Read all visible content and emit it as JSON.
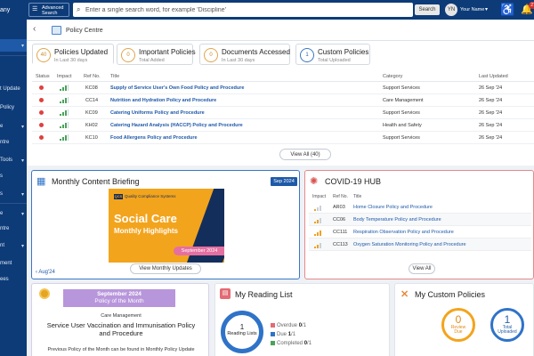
{
  "sidebar": {
    "brand_fragment": "any",
    "items": [
      {
        "label": ""
      },
      {
        "label": ""
      },
      {
        "label": "t Update"
      },
      {
        "label": "Policy"
      },
      {
        "label": "e"
      },
      {
        "label": "ntre"
      },
      {
        "label": "Tools"
      },
      {
        "label": "s"
      },
      {
        "label": "s"
      },
      {
        "label": "e"
      },
      {
        "label": "ntre"
      },
      {
        "label": "nt"
      },
      {
        "label": "ment"
      },
      {
        "label": "ees"
      }
    ]
  },
  "topbar": {
    "advanced_search_line1": "Advanced",
    "advanced_search_line2": "Search",
    "search_placeholder": "Enter a single search word, for example 'Discipline'",
    "search_button": "Search",
    "avatar_initials": "YN",
    "user_name": "Your Name",
    "notification_count": "27"
  },
  "breadcrumb": {
    "title": "Policy Centre"
  },
  "tabs": [
    {
      "count": "40",
      "title": "Policies Updated",
      "subtitle": "In Last 30 days"
    },
    {
      "count": "0",
      "title": "Important Policies",
      "subtitle": "Total Added"
    },
    {
      "count": "0",
      "title": "Documents Accessed",
      "subtitle": "In Last 30 days"
    },
    {
      "count": "1",
      "title": "Custom Policies",
      "subtitle": "Total Uploaded"
    }
  ],
  "policy_table": {
    "headers": {
      "status": "Status",
      "impact": "Impact",
      "ref": "Ref No.",
      "title": "Title",
      "category": "Category",
      "updated": "Last Updated"
    },
    "rows": [
      {
        "ref": "KC08",
        "title": "Supply of Service User's Own Food Policy and Procedure",
        "category": "Support Services",
        "updated": "26 Sep '24"
      },
      {
        "ref": "CC14",
        "title": "Nutrition and Hydration Policy and Procedure",
        "category": "Care Management",
        "updated": "26 Sep '24"
      },
      {
        "ref": "KC09",
        "title": "Catering Uniforms Policy and Procedure",
        "category": "Support Services",
        "updated": "26 Sep '24"
      },
      {
        "ref": "KH02",
        "title": "Catering Hazard Analysis (HACCP) Policy and Procedure",
        "category": "Health and Safety",
        "updated": "26 Sep '24"
      },
      {
        "ref": "KC10",
        "title": "Food Allergens Policy and Procedure",
        "category": "Support Services",
        "updated": "26 Sep '24"
      }
    ],
    "view_all": "View All (40)"
  },
  "monthly_briefing": {
    "title": "Monthly Content Briefing",
    "badge": "Sep 2024",
    "promo_logo_abbr": "QCS",
    "promo_logo_text": "Quality Compliance Systems",
    "promo_title": "Social Care",
    "promo_subtitle": "Monthly Highlights",
    "promo_month": "September 2024",
    "prev_link": "Aug'24",
    "button": "View Monthly Updates"
  },
  "covid_hub": {
    "title": "COVID-19 HUB",
    "headers": {
      "impact": "Impact",
      "ref": "Ref No.",
      "title": "Title"
    },
    "rows": [
      {
        "ref": "AR03",
        "title": "Home Closure Policy and Procedure"
      },
      {
        "ref": "CC06",
        "title": "Body Temperature Policy and Procedure"
      },
      {
        "ref": "CC111",
        "title": "Respiration Observation Policy and Procedure"
      },
      {
        "ref": "CC113",
        "title": "Oxygen Saturation Monitoring Policy and Procedure"
      }
    ],
    "button": "View All"
  },
  "policy_of_month": {
    "ribbon_line1": "September 2024",
    "ribbon_line2": "Policy of the Month",
    "category": "Care Management",
    "title": "Service User Vaccination and Immunisation Policy and Procedure",
    "footer": "Previous Policy of the Month can be found in Monthly Policy Update"
  },
  "reading_list": {
    "title": "My Reading List",
    "ring_count": "1",
    "ring_label": "Reading Lists",
    "legend": [
      {
        "label": "Overdue",
        "value": "0",
        "total": "/1",
        "color": "#e46a73"
      },
      {
        "label": "Due",
        "value": "1",
        "total": "/1",
        "color": "#2f73c8"
      },
      {
        "label": "Completed",
        "value": "0",
        "total": "/1",
        "color": "#4aa35a"
      }
    ]
  },
  "custom_policies": {
    "title": "My Custom Policies",
    "review_due_count": "0",
    "review_due_label_1": "Review",
    "review_due_label_2": "Due",
    "total_uploaded_count": "1",
    "total_uploaded_label_1": "Total",
    "total_uploaded_label_2": "Uploaded"
  }
}
